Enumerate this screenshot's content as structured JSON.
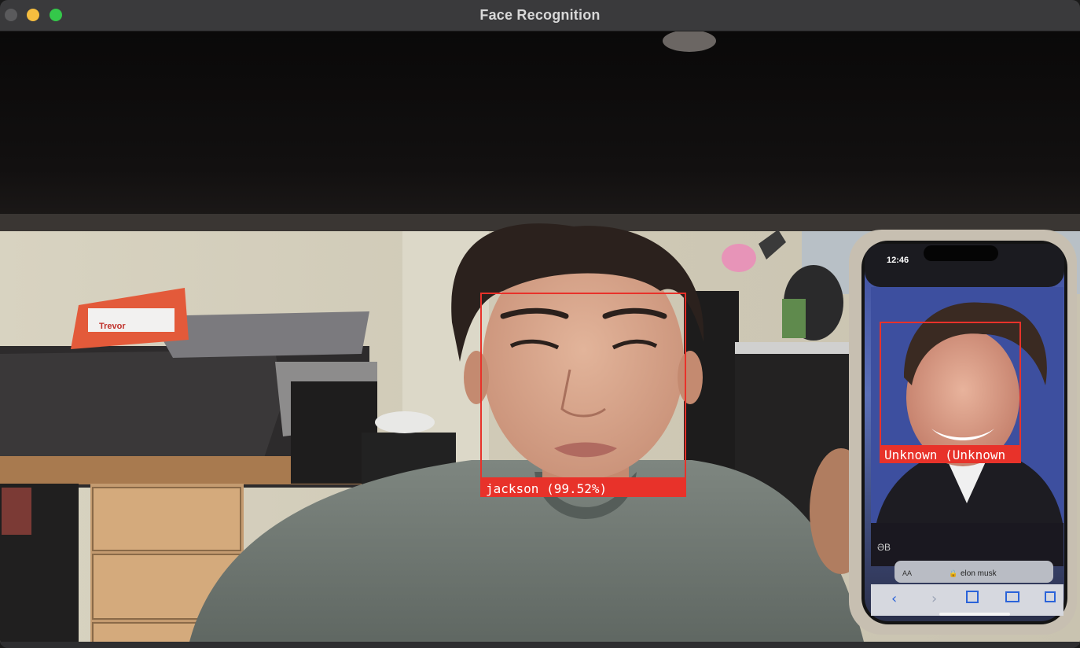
{
  "window": {
    "title": "Face Recognition"
  },
  "detections": [
    {
      "name": "jackson",
      "label": "jackson (99.52%)",
      "confidence_percent": 99.52
    },
    {
      "name": "Unknown",
      "label": "Unknown (Unknown"
    }
  ],
  "phone_screen": {
    "time": "12:46",
    "search_text": "elon musk",
    "text_size_button": "AA",
    "pillow_text": "Trevor"
  },
  "colors": {
    "box": "#e8322a",
    "titlebar": "#3a3a3c"
  }
}
